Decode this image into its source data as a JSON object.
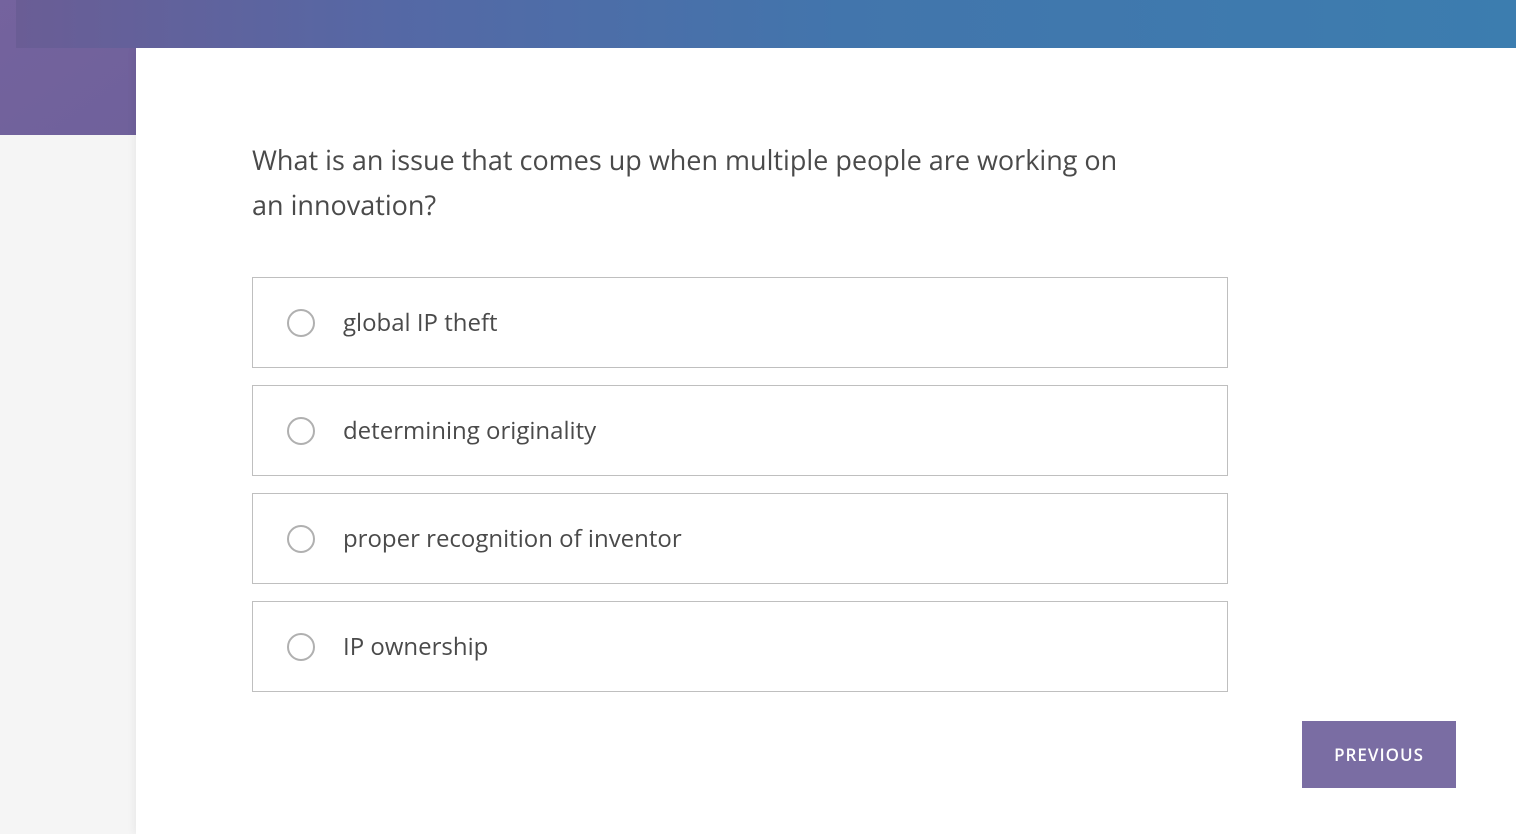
{
  "question": {
    "text": "What is an issue that comes up when multiple people are working on an innovation?",
    "options": [
      {
        "label": "global IP theft"
      },
      {
        "label": "determining originality"
      },
      {
        "label": "proper recognition of inventor"
      },
      {
        "label": "IP ownership"
      }
    ]
  },
  "navigation": {
    "previous_label": "PREVIOUS"
  }
}
